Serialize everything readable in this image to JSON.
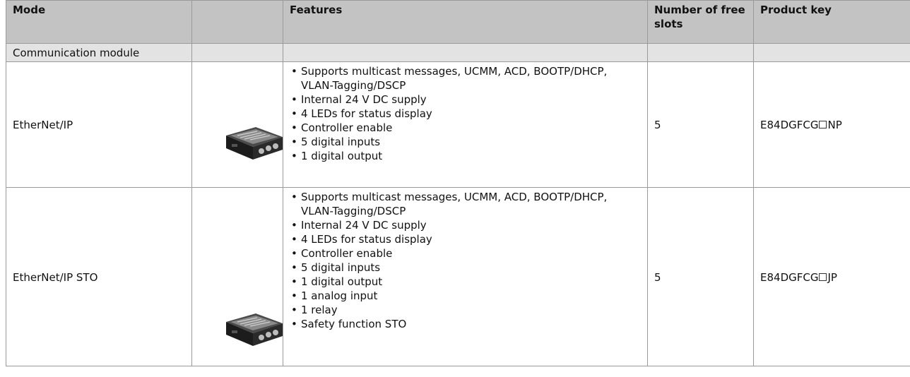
{
  "header": {
    "mode": "Mode",
    "image": "",
    "features": "Features",
    "slots": "Number of free slots",
    "key": "Product key"
  },
  "section_label": "Communication module",
  "rows": [
    {
      "mode": "EtherNet/IP",
      "image_icon": "communication-module-photo",
      "features": [
        "Supports multicast messages, UCMM, ACD, BOOTP/DHCP, VLAN-Tagging/DSCP",
        "Internal 24 V DC supply",
        "4 LEDs for status display",
        "Controller enable",
        "5 digital inputs",
        "1 digital output"
      ],
      "slots": "5",
      "key_prefix": "E84DGFCG",
      "key_suffix": "NP"
    },
    {
      "mode": "EtherNet/IP STO",
      "image_icon": "communication-module-photo",
      "features": [
        "Supports multicast messages, UCMM, ACD, BOOTP/DHCP, VLAN-Tagging/DSCP",
        "Internal 24 V DC supply",
        "4 LEDs for status display",
        "Controller enable",
        "5 digital inputs",
        "1 digital output",
        "1 analog input",
        "1 relay",
        "Safety function STO"
      ],
      "slots": "5",
      "key_prefix": "E84DGFCG",
      "key_suffix": "JP"
    }
  ]
}
